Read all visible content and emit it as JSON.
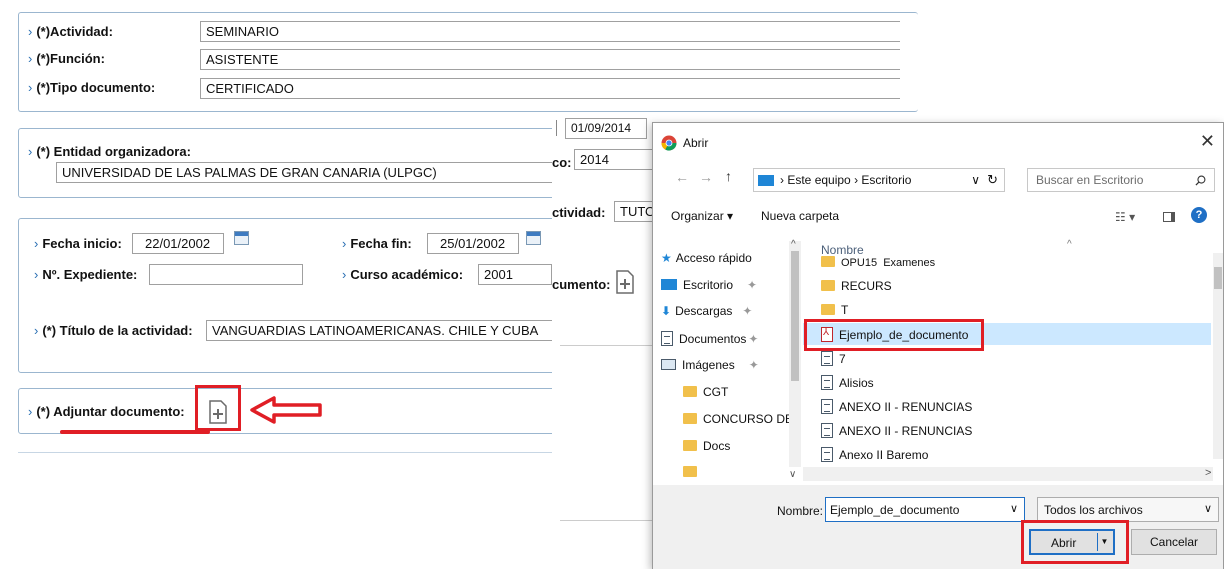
{
  "form": {
    "actividad_label": "(*)Actividad:",
    "actividad_value": "SEMINARIO",
    "funcion_label": "(*)Función:",
    "funcion_value": "ASISTENTE",
    "tipo_label": "(*)Tipo documento:",
    "tipo_value": "CERTIFICADO",
    "entidad_label": "(*) Entidad organizadora:",
    "entidad_value": "UNIVERSIDAD DE LAS PALMAS DE GRAN CANARIA (ULPGC)",
    "fecha_inicio_label": "Fecha inicio:",
    "fecha_inicio_value": "22/01/2002",
    "fecha_fin_label": "Fecha fin:",
    "fecha_fin_value": "25/01/2002",
    "expediente_label": "Nº. Expediente:",
    "expediente_value": "",
    "curso_label": "Curso académico:",
    "curso_value": "2001",
    "titulo_label": "(*) Título de la actividad:",
    "titulo_value": "VANGUARDIAS LATINOAMERICANAS. CHILE Y CUBA",
    "adjuntar_label": "(*) Adjuntar documento:",
    "chevron": "›"
  },
  "background_window": {
    "date_value": "01/09/2014",
    "co_label": "co:",
    "co_value": "2014",
    "actividad_label": "ctividad:",
    "actividad_value": "TUTO",
    "documento_label": "cumento:"
  },
  "dialog": {
    "title": "Abrir",
    "close": "✕",
    "nav_back": "←",
    "nav_forward": "→",
    "nav_up": "↑",
    "address_path": [
      "Este equipo",
      "Escritorio"
    ],
    "address_sep": "›",
    "address_dropdown": "∨",
    "refresh": "↻",
    "search_placeholder": "Buscar en Escritorio",
    "organize": "Organizar ▾",
    "new_folder": "Nueva carpeta",
    "sidebar": [
      {
        "label": "Acceso rápido",
        "icon": "star-icon"
      },
      {
        "label": "Escritorio",
        "icon": "desktop-icon"
      },
      {
        "label": "Descargas",
        "icon": "download-icon"
      },
      {
        "label": "Documentos",
        "icon": "document-icon"
      },
      {
        "label": "Imágenes",
        "icon": "image-icon"
      },
      {
        "label": "CGT",
        "icon": "folder-icon"
      },
      {
        "label": "CONCURSO DE T",
        "icon": "folder-icon"
      },
      {
        "label": "Docs",
        "icon": "folder-icon"
      }
    ],
    "column_header": "Nombre",
    "files": [
      {
        "name": "OPU15_Examenes",
        "icon": "folder"
      },
      {
        "name": "RECURS",
        "icon": "folder"
      },
      {
        "name": "T",
        "icon": "folder"
      },
      {
        "name": "Ejemplo_de_documento",
        "icon": "pdf"
      },
      {
        "name": "7",
        "icon": "doc"
      },
      {
        "name": "Alisios",
        "icon": "doc"
      },
      {
        "name": "ANEXO II - RENUNCIAS",
        "icon": "doc"
      },
      {
        "name": "ANEXO II - RENUNCIAS",
        "icon": "doc"
      },
      {
        "name": "Anexo II Baremo",
        "icon": "doc"
      }
    ],
    "filename_label": "Nombre:",
    "filename_value": "Ejemplo_de_documento",
    "filter_value": "Todos los archivos",
    "open_button": "Abrir",
    "cancel_button": "Cancelar"
  },
  "colors": {
    "highlight_red": "#e01e25",
    "chevron_blue": "#2a6fb3",
    "selection_blue": "#cce8ff"
  }
}
